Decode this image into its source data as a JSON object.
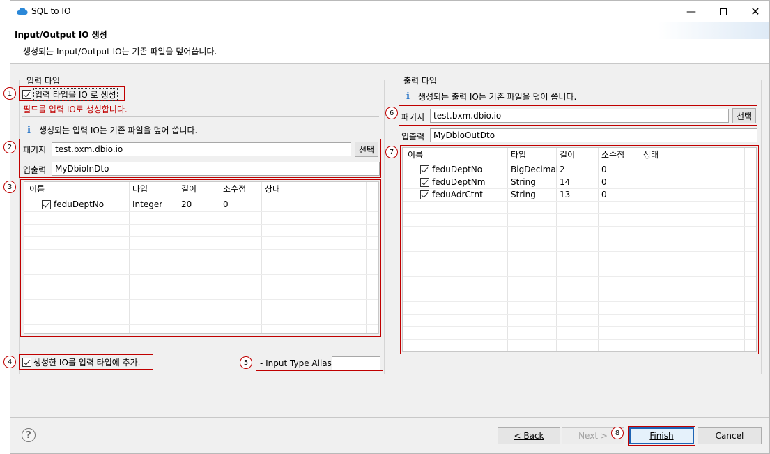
{
  "window": {
    "title": "SQL to IO"
  },
  "header": {
    "title": "Input/Output IO 생성",
    "description": "생성되는 Input/Output IO는 기존 파일을 덮어씁니다."
  },
  "input_group": {
    "title": "입력 타입",
    "gen_checkbox_label": "입력 타입을 IO 로 생성",
    "gen_hint": "필드를 입력 IO로 생성합니다.",
    "info": "생성되는 입력 IO는 기존 파일을 덮어 씁니다.",
    "package_label": "패키지",
    "package_value": "test.bxm.dbio.io",
    "select_label": "선택",
    "io_label": "입출력",
    "io_value": "MyDbioInDto",
    "columns": [
      "이름",
      "타입",
      "길이",
      "소수점",
      "상태"
    ],
    "rows": [
      {
        "name": "feduDeptNo",
        "type": "Integer",
        "length": "20",
        "scale": "0",
        "status": ""
      }
    ],
    "add_checkbox_label": "생성한 IO를 입력 타입에 추가.",
    "alias_label": "- Input Type Alias:",
    "alias_value": ""
  },
  "output_group": {
    "title": "출력 타입",
    "info": "생성되는 출력 IO는 기존 파일을 덮어 씁니다.",
    "package_label": "패키지",
    "package_value": "test.bxm.dbio.io",
    "select_label": "선택",
    "io_label": "입출력",
    "io_value": "MyDbioOutDto",
    "columns": [
      "이름",
      "타입",
      "길이",
      "소수점",
      "상태"
    ],
    "rows": [
      {
        "name": "feduDeptNo",
        "type": "BigDecimal",
        "length": "2",
        "scale": "0",
        "status": ""
      },
      {
        "name": "feduDeptNm",
        "type": "String",
        "length": "14",
        "scale": "0",
        "status": ""
      },
      {
        "name": "feduAdrCtnt",
        "type": "String",
        "length": "13",
        "scale": "0",
        "status": ""
      }
    ]
  },
  "markers": [
    "1",
    "2",
    "3",
    "4",
    "5",
    "6",
    "7",
    "8"
  ],
  "footer": {
    "help": "?",
    "back": "< Back",
    "next": "Next >",
    "finish": "Finish",
    "cancel": "Cancel"
  },
  "colors": {
    "annotation": "#c00000",
    "info": "#1f6fc5",
    "hint": "#c00000"
  }
}
